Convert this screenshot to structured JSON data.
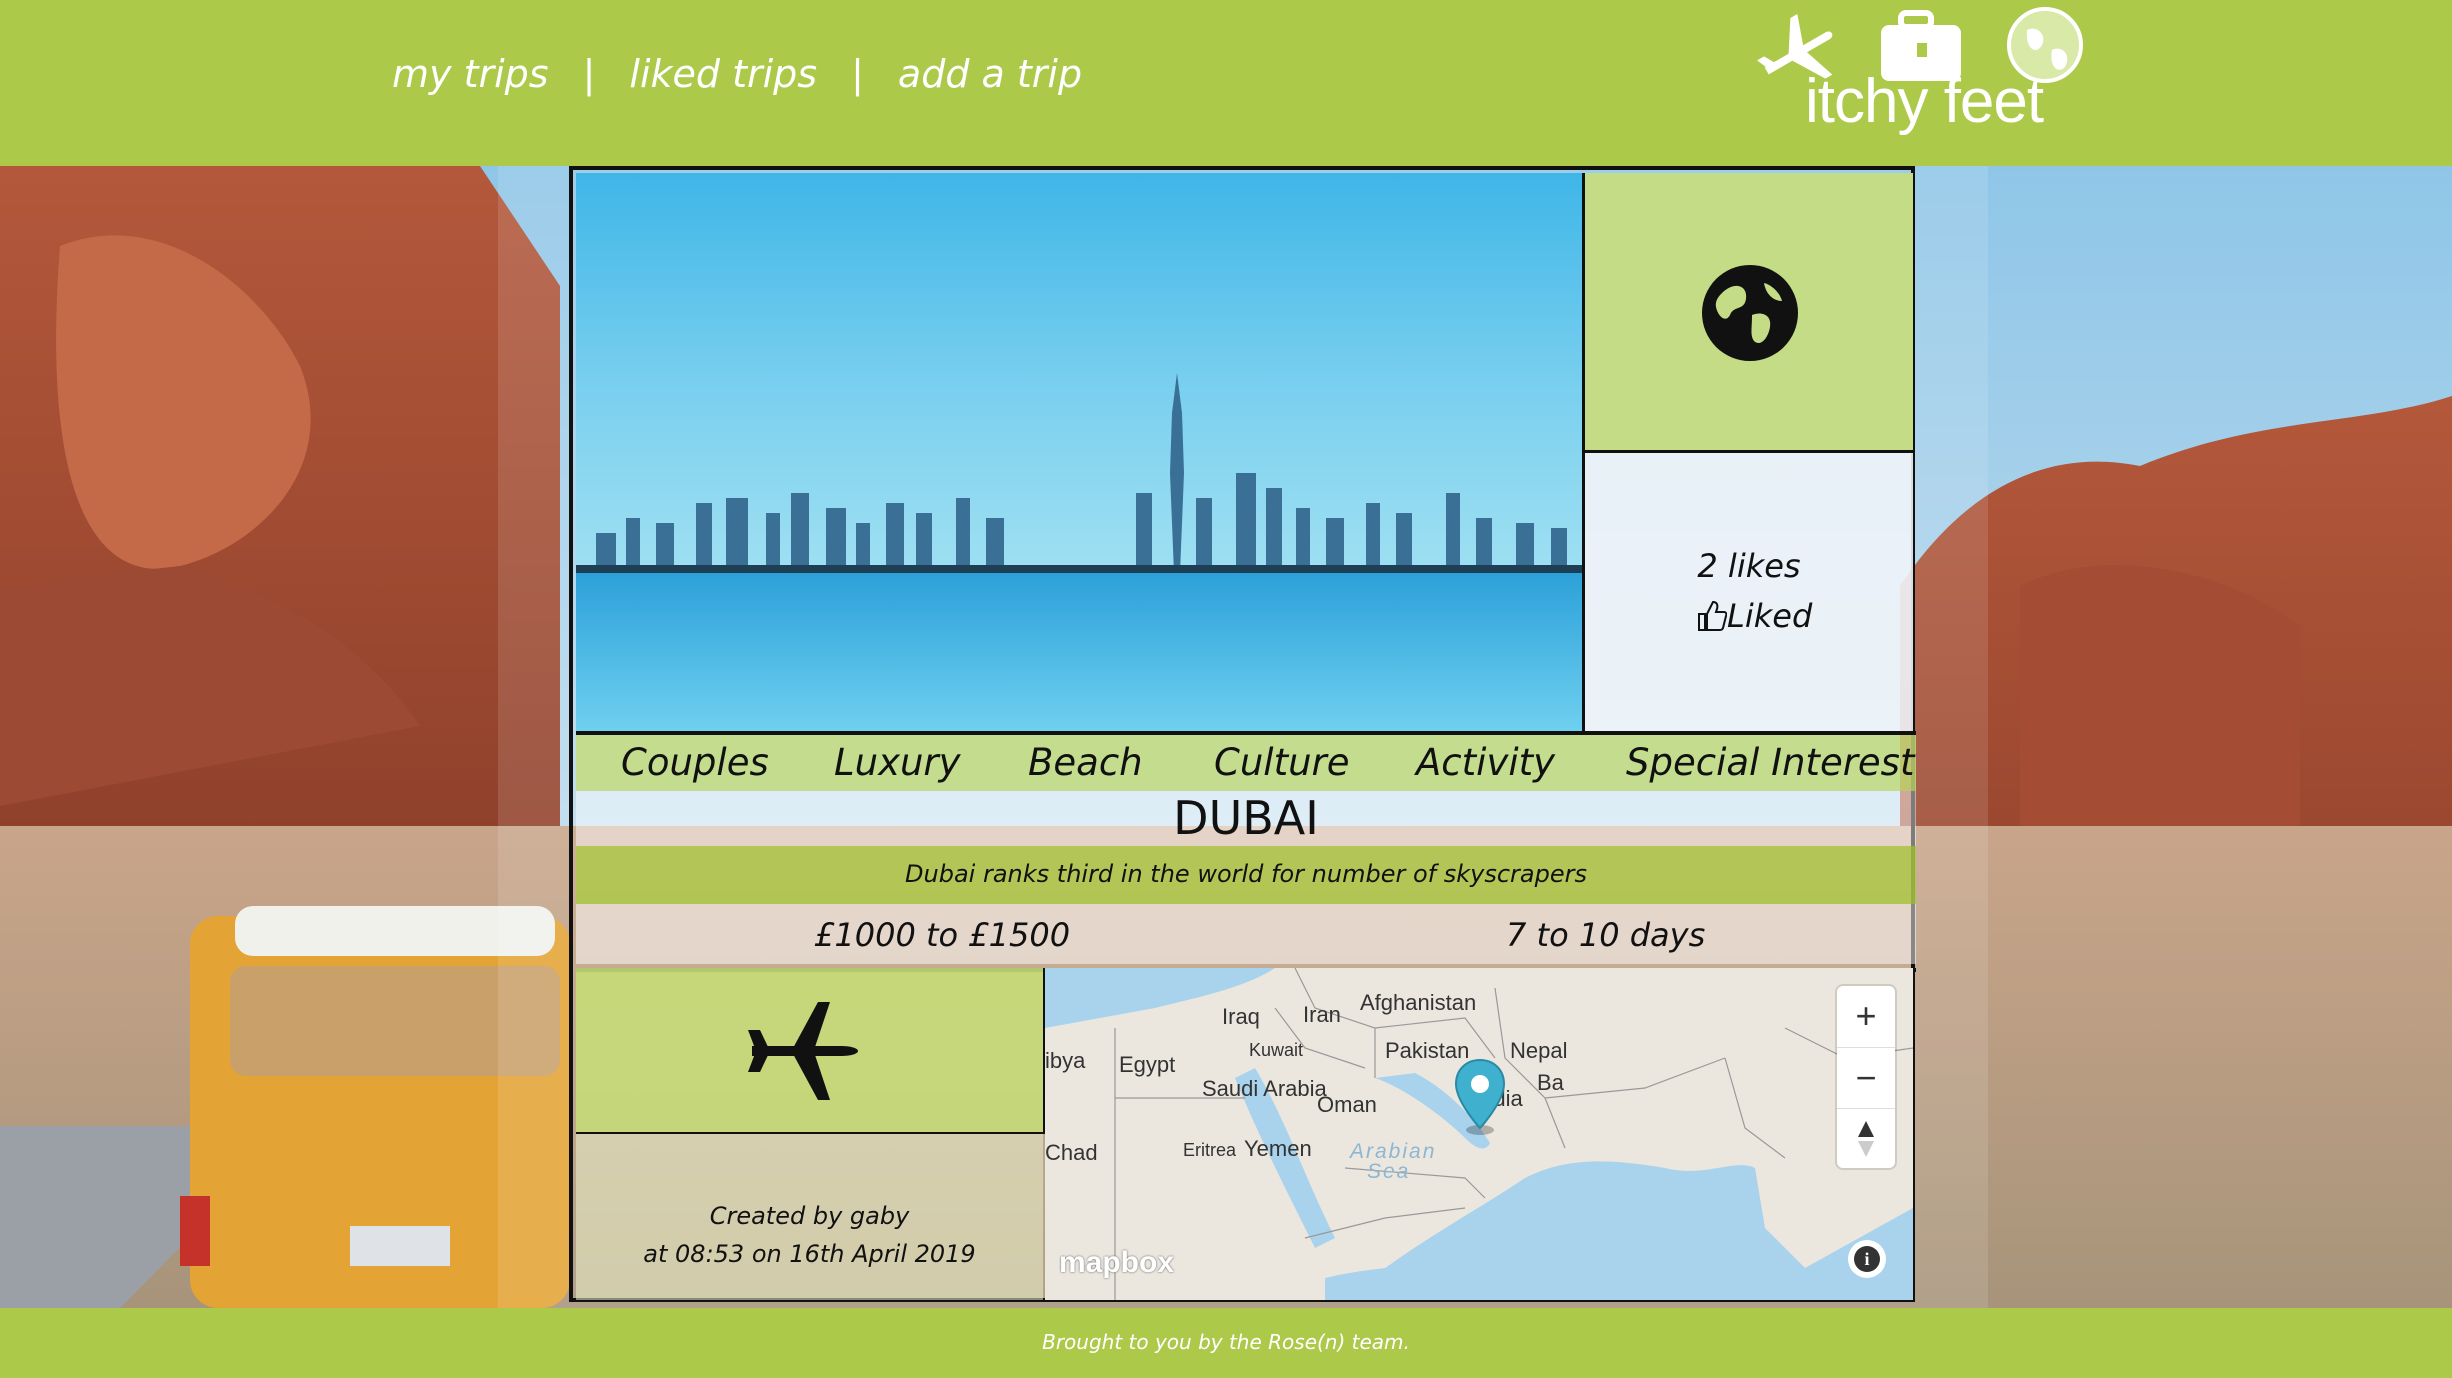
{
  "nav": {
    "my_trips": "my trips",
    "sep1": "|",
    "liked_trips": "liked trips",
    "sep2": "|",
    "add_trip": "add a trip"
  },
  "logo": {
    "text": "itchy feet",
    "icons": [
      "airplane-icon",
      "suitcase-icon",
      "globe-icon"
    ]
  },
  "trip": {
    "likes": "2 likes",
    "liked_label": "Liked",
    "tags": [
      "Couples",
      "Luxury",
      "Beach",
      "Culture",
      "Activity",
      "Special Interest"
    ],
    "title": "DUBAI",
    "description": "Dubai ranks third in the world for number of skyscrapers",
    "cost": "£1000 to £1500",
    "duration": "7 to 10 days",
    "created_by": "Created by gaby",
    "created_at": "at 08:53 on 16th April 2019"
  },
  "map": {
    "countries": [
      "Iraq",
      "Iran",
      "Afghanistan",
      "Kuwait",
      "Pakistan",
      "Nepal",
      "ibya",
      "Egypt",
      "Saudi Arabia",
      "Oman",
      "India",
      "Ba",
      "Chad",
      "Eritrea",
      "Yemen"
    ],
    "seas": [
      "Arabian",
      "Sea"
    ],
    "zoom_in": "+",
    "zoom_out": "−",
    "attribution": "mapbox",
    "info": "i"
  },
  "footer": {
    "text": "Brought to you by the Rose(n) team."
  },
  "colors": {
    "brand_green": "#adc94a",
    "panel_green": "#c5dc86",
    "marker": "#3fb1ce"
  }
}
